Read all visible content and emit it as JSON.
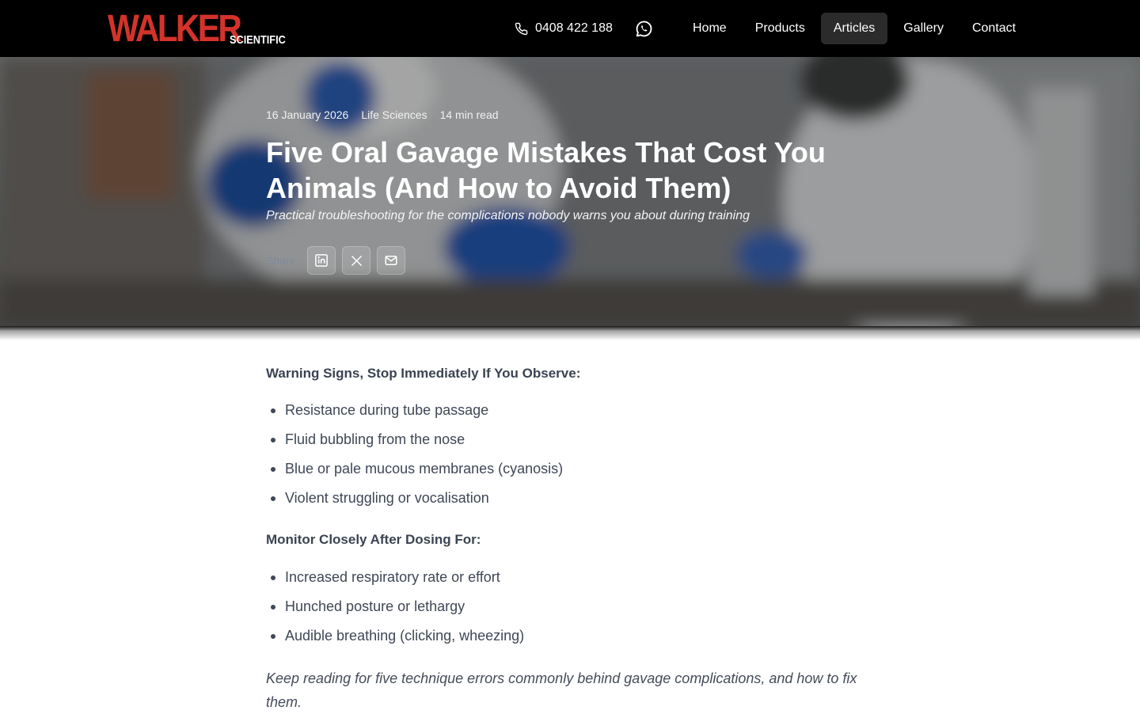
{
  "brand": {
    "name": "WALKER",
    "sub": "SCIENTIFIC",
    "color": "#d3332b"
  },
  "header": {
    "phone": "0408 422 188",
    "phone_icon": "phone-icon",
    "whatsapp_icon": "whatsapp-icon"
  },
  "nav": {
    "items": [
      {
        "label": "Home"
      },
      {
        "label": "Products"
      },
      {
        "label": "Articles",
        "active": true
      },
      {
        "label": "Gallery"
      },
      {
        "label": "Contact"
      }
    ]
  },
  "article": {
    "date": "16 January 2026",
    "category": "Life Sciences",
    "read_time": "14 min read",
    "title": "Five Oral Gavage Mistakes That Cost You Animals (And How to Avoid Them)",
    "subtitle": "Practical troubleshooting for the complications nobody warns you about during training",
    "share": {
      "label": "Share",
      "buttons": [
        "linkedin-icon",
        "x-icon",
        "mail-icon"
      ]
    }
  },
  "body": {
    "warning_heading": "Warning Signs, Stop Immediately If You Observe:",
    "warning_items": [
      "Resistance during tube passage",
      "Fluid bubbling from the nose",
      "Blue or pale mucous membranes (cyanosis)",
      "Violent struggling or vocalisation"
    ],
    "monitor_heading": "Monitor Closely After Dosing For:",
    "monitor_items": [
      "Increased respiratory rate or effort",
      "Hunched posture or lethargy",
      "Audible breathing (clicking, wheezing)"
    ],
    "closing": "Keep reading for five technique errors commonly behind gavage complications, and how to fix them."
  }
}
